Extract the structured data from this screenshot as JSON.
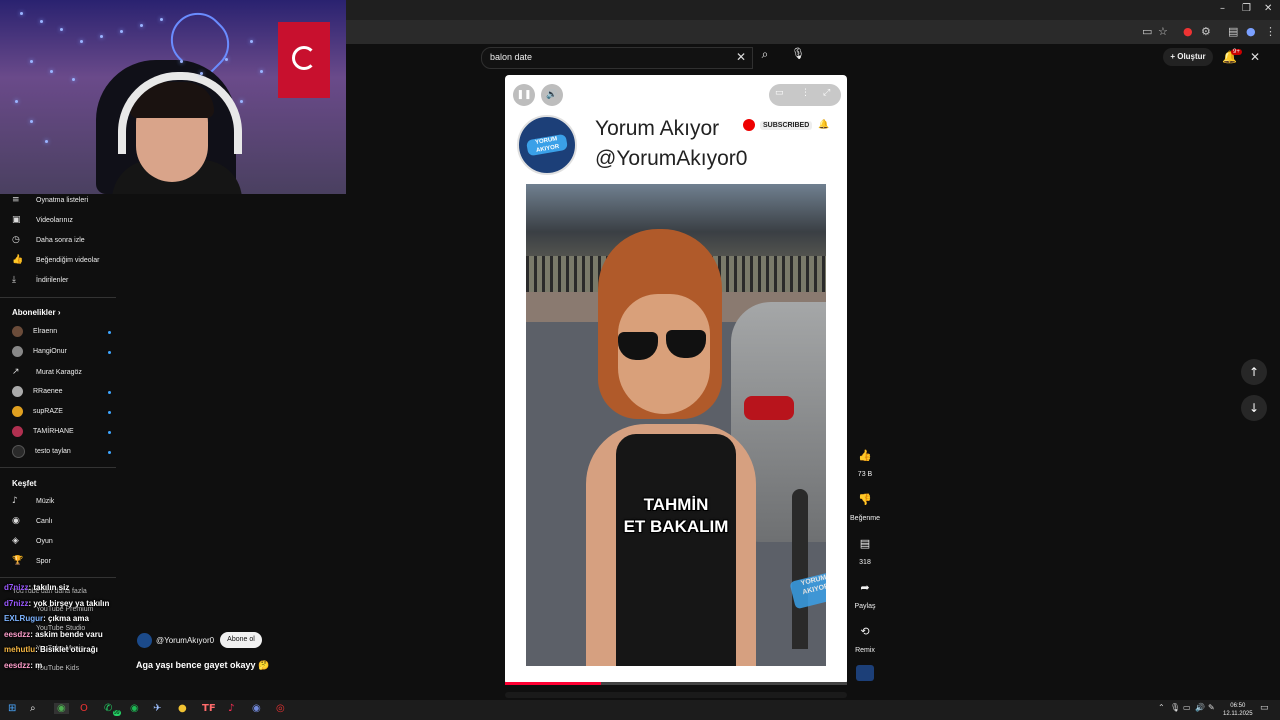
{
  "search": {
    "query": "balon date"
  },
  "header": {
    "create_label": "Oluştur",
    "notification_count": "9+"
  },
  "sidebar": {
    "items": [
      {
        "label": "Oynatma listeleri",
        "icon": "playlist-icon"
      },
      {
        "label": "Videolarınız",
        "icon": "your-videos-icon"
      },
      {
        "label": "Daha sonra izle",
        "icon": "watch-later-icon"
      },
      {
        "label": "Beğendiğim videolar",
        "icon": "liked-icon"
      },
      {
        "label": "İndirilenler",
        "icon": "download-icon"
      }
    ],
    "subscriptions_title": "Abonelikler",
    "subscriptions": [
      {
        "label": "Elraenn",
        "color": "#6b4c3a"
      },
      {
        "label": "HangiOnur",
        "color": "#888888"
      },
      {
        "label": "Murat Karagöz",
        "color": "#222222"
      },
      {
        "label": "RRaenee",
        "color": "#aaaaaa"
      },
      {
        "label": "supRAZE",
        "color": "#e0a020"
      },
      {
        "label": "TAMİRHANE",
        "color": "#b03050"
      },
      {
        "label": "testo taylan",
        "color": "#2a2a2a"
      }
    ],
    "explore_title": "Keşfet",
    "explore": [
      {
        "label": "Müzik"
      },
      {
        "label": "Canlı"
      },
      {
        "label": "Oyun"
      },
      {
        "label": "Spor"
      }
    ],
    "more": [
      "YouTube'dan daha fazla",
      "YouTube Premium",
      "YouTube Studio",
      "YouTube Music",
      "YouTube Kids"
    ]
  },
  "chat": [
    {
      "user": "d7nizz",
      "msg": ": takılın siz",
      "color": "#9b59ff"
    },
    {
      "user": "d7nizz",
      "msg": ": yok birşey ya takılın",
      "color": "#9b59ff"
    },
    {
      "user": "EXLRugur",
      "msg": ": çıkma ama",
      "color": "#7db3ff"
    },
    {
      "user": "eesdzz",
      "msg": ": askim bende varu",
      "color": "#ff9ecb"
    },
    {
      "user": "mehutlu",
      "msg": ": Bisiklet oturağı",
      "color": "#f5b642"
    },
    {
      "user": "eesdzz",
      "msg": ": m",
      "color": "#ff9ecb"
    }
  ],
  "short": {
    "channel_name": "Yorum Akıyor",
    "channel_handle": "@YorumAkıyor0",
    "subscribed_label": "SUBSCRIBED",
    "logo_text": "YORUM AKIYOR",
    "caption_line1": "TAHMİN",
    "caption_line2": "ET BAKALIM",
    "watermark": "YORUM AKIYOR",
    "progress": 0.28,
    "small_channel": "@YorumAkıyor0",
    "subscribe_label": "Abone ol",
    "title": "Aga yaşı bence gayet okayy 🤔"
  },
  "actions": {
    "likes": "73 B",
    "dislike_label": "Beğenme",
    "comments": "318",
    "share_label": "Paylaş",
    "remix_label": "Remix"
  },
  "taskbar": {
    "time": "06:50",
    "date": "12.11.2025",
    "whatsapp_badge": "99"
  },
  "colors": {
    "accent": "#ff0033",
    "link": "#3ea6ff"
  }
}
